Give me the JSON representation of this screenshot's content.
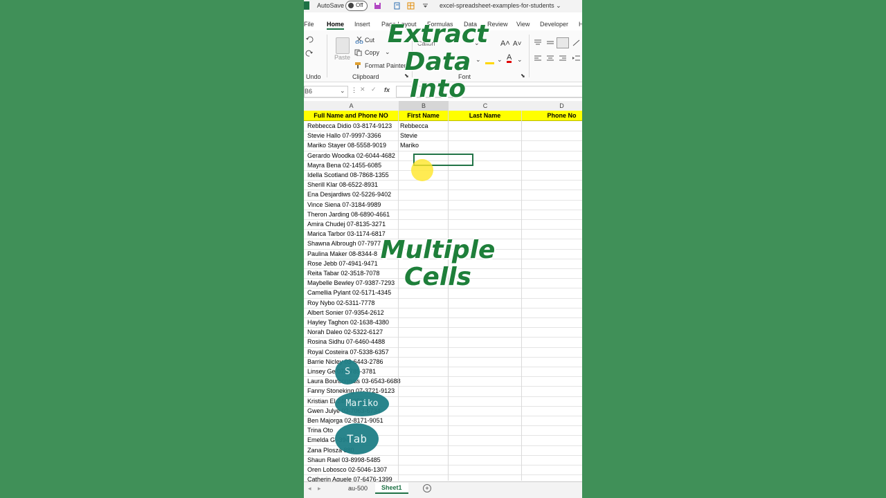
{
  "titlebar": {
    "autosave_label": "AutoSave",
    "autosave_state": "Off",
    "file_name": "excel-spreadsheet-examples-for-students"
  },
  "ribbon_tabs": [
    "File",
    "Home",
    "Insert",
    "Page Layout",
    "Formulas",
    "Data",
    "Review",
    "View",
    "Developer",
    "H"
  ],
  "active_tab": "Home",
  "ribbon": {
    "undo_group": "Undo",
    "paste": "Paste",
    "cut": "Cut",
    "copy": "Copy",
    "format_painter": "Format Painter",
    "clipboard_group": "Clipboard",
    "font_group": "Font",
    "font_name": "Calibri"
  },
  "formula_bar": {
    "name_box": "B6",
    "fx": "fx",
    "formula": ""
  },
  "columns": [
    "A",
    "B",
    "C",
    "D"
  ],
  "headers": [
    "Full Name and Phone NO",
    "First Name",
    "Last Name",
    "Phone No"
  ],
  "rows": [
    {
      "a": "Rebbecca Didio 03-8174-9123",
      "b": "Rebbecca"
    },
    {
      "a": "Stevie Hallo 07-9997-3366",
      "b": "Stevie"
    },
    {
      "a": "Mariko Stayer 08-5558-9019",
      "b": "Mariko"
    },
    {
      "a": "Gerardo Woodka 02-6044-4682",
      "b": ""
    },
    {
      "a": "Mayra Bena 02-1455-6085",
      "b": ""
    },
    {
      "a": "Idella Scotland 08-7868-1355",
      "b": ""
    },
    {
      "a": "Sherill Klar 08-6522-8931",
      "b": ""
    },
    {
      "a": "Ena Desjardiws 02-5226-9402",
      "b": ""
    },
    {
      "a": "Vince Siena 07-3184-9989",
      "b": ""
    },
    {
      "a": "Theron Jarding 08-6890-4661",
      "b": ""
    },
    {
      "a": "Amira Chudej 07-8135-3271",
      "b": ""
    },
    {
      "a": "Marica Tarbor 03-1174-6817",
      "b": ""
    },
    {
      "a": "Shawna Albrough 07-7977",
      "b": ""
    },
    {
      "a": "Paulina Maker 08-8344-8",
      "b": ""
    },
    {
      "a": "Rose Jebb 07-4941-9471",
      "b": ""
    },
    {
      "a": "Reita Tabar 02-3518-7078",
      "b": ""
    },
    {
      "a": "Maybelle Bewley 07-9387-7293",
      "b": ""
    },
    {
      "a": "Camellia Pylant 02-5171-4345",
      "b": ""
    },
    {
      "a": "Roy Nybo 02-5311-7778",
      "b": ""
    },
    {
      "a": "Albert Sonier 07-9354-2612",
      "b": ""
    },
    {
      "a": "Hayley Taghon 02-1638-4380",
      "b": ""
    },
    {
      "a": "Norah Daleo 02-5322-6127",
      "b": ""
    },
    {
      "a": "Rosina Sidhu 07-6460-4488",
      "b": ""
    },
    {
      "a": "Royal Costeira 07-5338-6357",
      "b": ""
    },
    {
      "a": "Barrie Nicley 03-6443-2786",
      "b": ""
    },
    {
      "a": "Linsey Ge 07-4785-3781",
      "b": ""
    },
    {
      "a": "Laura Bourbonnais 03-6543-6688",
      "b": ""
    },
    {
      "a": "Fanny Stoneking 07-3721-9123",
      "b": ""
    },
    {
      "a": "Kristian El 246-1250",
      "b": ""
    },
    {
      "a": "Gwen Julye 03-7063-6734",
      "b": ""
    },
    {
      "a": "Ben Majorga 02-8171-9051",
      "b": ""
    },
    {
      "a": "Trina Oto",
      "b": ""
    },
    {
      "a": "Emelda G -3947",
      "b": ""
    },
    {
      "a": "Zana Plosza 880",
      "b": ""
    },
    {
      "a": "Shaun Rael 03-8998-5485",
      "b": ""
    },
    {
      "a": "Oren Lobosco 02-5046-1307",
      "b": ""
    },
    {
      "a": "Catherin Aguele 07-6476-1399",
      "b": ""
    }
  ],
  "sheet_tabs": [
    "au-500",
    "Sheet1"
  ],
  "active_sheet": "Sheet1",
  "overlay": {
    "line1": "Extract",
    "line2": "Data",
    "line3": "Into",
    "line4": "Multiple",
    "line5": "Cells"
  },
  "keystrokes": [
    "S",
    "Mariko",
    "Tab"
  ],
  "colors": {
    "background": "#409058",
    "header_fill": "#ffff00",
    "excel_green": "#1e7145",
    "overlay_text": "#1e7f3a",
    "keystroke_bubble": "#1f7f86"
  }
}
